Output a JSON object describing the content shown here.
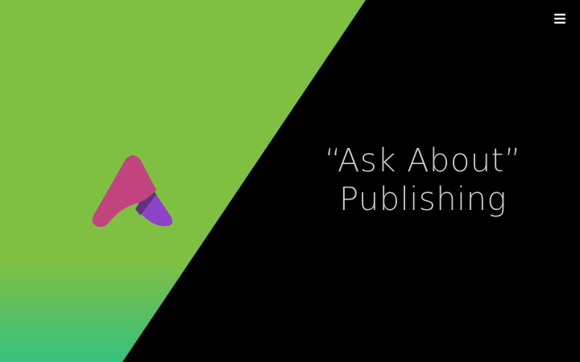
{
  "hero": {
    "headline_line1": "“Ask About”",
    "headline_line2": "Publishing"
  },
  "header": {
    "menu_icon": "hamburger-menu-icon"
  },
  "logo": {
    "icon": "ask-about-a-logo-icon"
  },
  "colors": {
    "panel_green": "#7fc043",
    "panel_gradient_bottom": "#36c17f",
    "background_black": "#000000",
    "logo_pink": "#c1447f",
    "logo_purple": "#8e42c8",
    "logo_dark_fold": "#5a2f73",
    "headline_text": "#c9c9c9",
    "menu_icon": "#ffffff"
  }
}
